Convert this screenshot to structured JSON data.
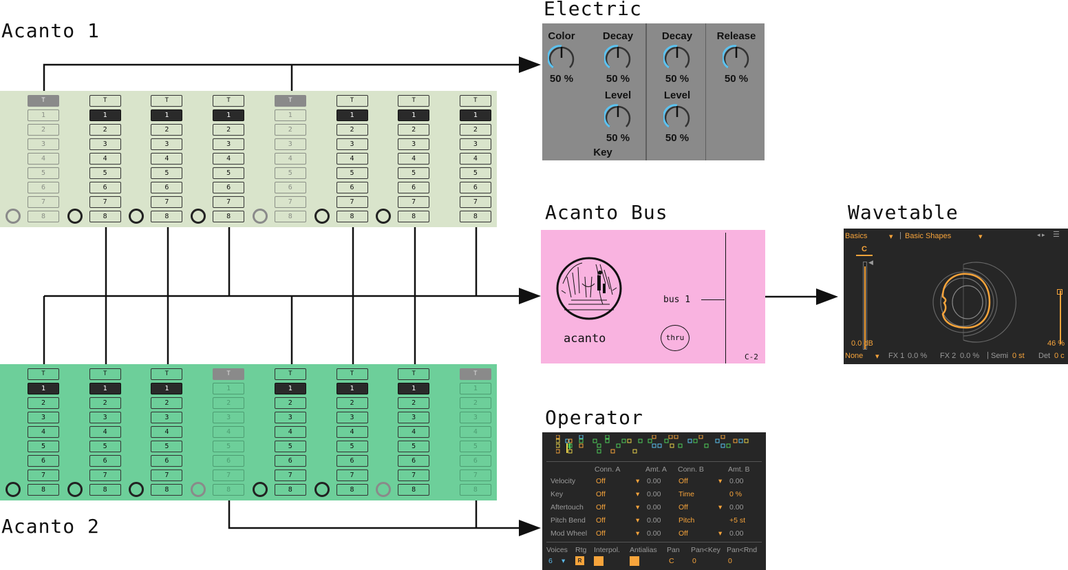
{
  "titles": {
    "acanto1": "Acanto 1",
    "acanto2": "Acanto 2",
    "electric": "Electric",
    "acanto_bus": "Acanto Bus",
    "wavetable": "Wavetable",
    "operator": "Operator"
  },
  "sequencer": {
    "thru_label": "T",
    "steps": [
      "1",
      "2",
      "3",
      "4",
      "5",
      "6",
      "7",
      "8"
    ]
  },
  "electric": {
    "color_label": "Color",
    "color_value": "50 %",
    "decay1_label": "Decay",
    "decay1_value": "50 %",
    "level1_label": "Level",
    "level1_value": "50 %",
    "key_label": "Key",
    "decay2_label": "Decay",
    "decay2_value": "50 %",
    "level2_label": "Level",
    "level2_value": "50 %",
    "release_label": "Release",
    "release_value": "50 %",
    "knob_color": "#5bc2f0"
  },
  "acanto_bus": {
    "logo_text": "acanto",
    "bus_label": "bus 1",
    "thru_button": "thru",
    "note": "C-2"
  },
  "wavetable": {
    "category": "Basics",
    "preset": "Basic Shapes",
    "pitch_label": "C",
    "gain_value": "0.0 dB",
    "percent_value": "46 %",
    "filter_type": "None",
    "fx1": "FX 1",
    "fx1_value": "0.0 %",
    "fx2": "FX 2",
    "fx2_value": "0.0 %",
    "semi": "Semi",
    "semi_value": "0 st",
    "det": "Det",
    "det_value": "0 c",
    "accent": "#f7a43b"
  },
  "operator": {
    "headers": {
      "conn_a": "Conn. A",
      "amt_a": "Amt. A",
      "conn_b": "Conn. B",
      "amt_b": "Amt. B"
    },
    "rows": [
      {
        "name": "Velocity",
        "conn_a": "Off",
        "amt_a": "0.00",
        "conn_b": "Off",
        "amt_b": "0.00"
      },
      {
        "name": "Key",
        "conn_a": "Off",
        "amt_a": "0.00",
        "conn_b": "Time",
        "amt_b": "0 %"
      },
      {
        "name": "Aftertouch",
        "conn_a": "Off",
        "amt_a": "0.00",
        "conn_b": "Off",
        "amt_b": "0.00"
      },
      {
        "name": "Pitch Bend",
        "conn_a": "Off",
        "amt_a": "0.00",
        "conn_b": "Pitch",
        "amt_b": "+5 st"
      },
      {
        "name": "Mod Wheel",
        "conn_a": "Off",
        "amt_a": "0.00",
        "conn_b": "Off",
        "amt_b": "0.00"
      }
    ],
    "footer": {
      "voices_label": "Voices",
      "voices_value": "6",
      "rtg_label": "Rtg",
      "rtg_value": "R",
      "interpol_label": "Interpol.",
      "antialias_label": "Antialias",
      "pan_label": "Pan",
      "pan_value": "C",
      "pankey_label": "Pan<Key",
      "pankey_value": "0",
      "panrnd_label": "Pan<Rnd",
      "panrnd_value": "0"
    }
  }
}
